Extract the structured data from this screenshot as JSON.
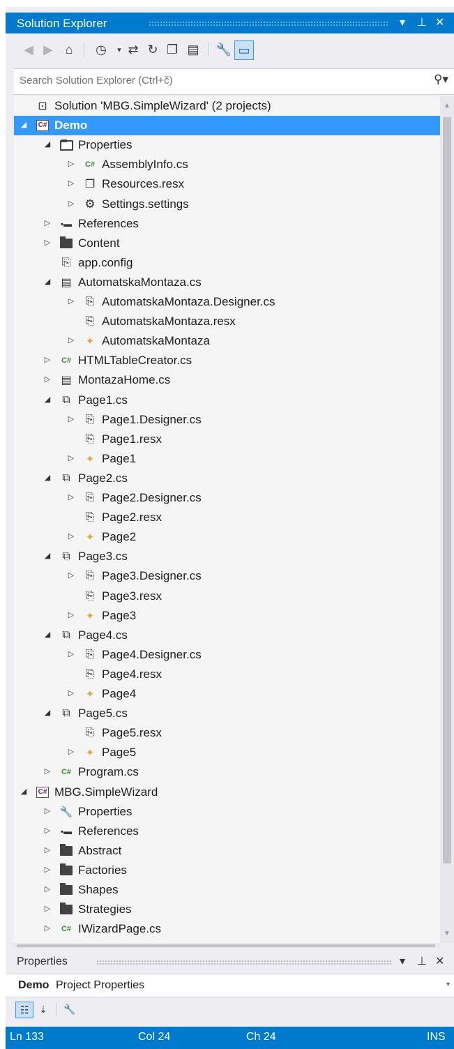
{
  "solution_explorer": {
    "title": "Solution Explorer",
    "controls": {
      "dropdown": "▾",
      "pin": "⊥",
      "close": "✕"
    },
    "search_placeholder": "Search Solution Explorer (Ctrl+č)",
    "toolbar": [
      "back-icon",
      "forward-icon",
      "home-icon",
      "pending-changes-icon",
      "sync-icon",
      "refresh-icon",
      "collapse-all-icon",
      "show-all-files-icon",
      "properties-icon",
      "preview-icon"
    ],
    "tree": [
      {
        "label": "Solution 'MBG.SimpleWizard' (2 projects)",
        "level": 0,
        "icon": "solution-icon",
        "expander": "none"
      },
      {
        "label": "Demo",
        "level": 0,
        "icon": "csproj-icon",
        "expander": "open",
        "selected": true
      },
      {
        "label": "Properties",
        "level": 1,
        "icon": "folder-open-icon",
        "expander": "open"
      },
      {
        "label": "AssemblyInfo.cs",
        "level": 2,
        "icon": "cs-file-icon",
        "expander": "closed"
      },
      {
        "label": "Resources.resx",
        "level": 2,
        "icon": "resx-icon",
        "expander": "closed"
      },
      {
        "label": "Settings.settings",
        "level": 2,
        "icon": "settings-icon",
        "expander": "closed"
      },
      {
        "label": "References",
        "level": 1,
        "icon": "references-icon",
        "expander": "closed"
      },
      {
        "label": "Content",
        "level": 1,
        "icon": "folder-icon",
        "expander": "closed"
      },
      {
        "label": "app.config",
        "level": 1,
        "icon": "config-icon",
        "expander": "none"
      },
      {
        "label": "AutomatskaMontaza.cs",
        "level": 1,
        "icon": "form-icon",
        "expander": "open"
      },
      {
        "label": "AutomatskaMontaza.Designer.cs",
        "level": 2,
        "icon": "designer-icon",
        "expander": "closed"
      },
      {
        "label": "AutomatskaMontaza.resx",
        "level": 2,
        "icon": "designer-icon",
        "expander": "none"
      },
      {
        "label": "AutomatskaMontaza",
        "level": 2,
        "icon": "class-icon",
        "expander": "closed"
      },
      {
        "label": "HTMLTableCreator.cs",
        "level": 1,
        "icon": "cs-file-icon",
        "expander": "closed"
      },
      {
        "label": "MontazaHome.cs",
        "level": 1,
        "icon": "form-icon",
        "expander": "closed"
      },
      {
        "label": "Page1.cs",
        "level": 1,
        "icon": "usercontrol-icon",
        "expander": "open"
      },
      {
        "label": "Page1.Designer.cs",
        "level": 2,
        "icon": "designer-icon",
        "expander": "closed"
      },
      {
        "label": "Page1.resx",
        "level": 2,
        "icon": "designer-icon",
        "expander": "none"
      },
      {
        "label": "Page1",
        "level": 2,
        "icon": "class-icon",
        "expander": "closed"
      },
      {
        "label": "Page2.cs",
        "level": 1,
        "icon": "usercontrol-icon",
        "expander": "open"
      },
      {
        "label": "Page2.Designer.cs",
        "level": 2,
        "icon": "designer-icon",
        "expander": "closed"
      },
      {
        "label": "Page2.resx",
        "level": 2,
        "icon": "designer-icon",
        "expander": "none"
      },
      {
        "label": "Page2",
        "level": 2,
        "icon": "class-icon",
        "expander": "closed"
      },
      {
        "label": "Page3.cs",
        "level": 1,
        "icon": "usercontrol-icon",
        "expander": "open"
      },
      {
        "label": "Page3.Designer.cs",
        "level": 2,
        "icon": "designer-icon",
        "expander": "closed"
      },
      {
        "label": "Page3.resx",
        "level": 2,
        "icon": "designer-icon",
        "expander": "none"
      },
      {
        "label": "Page3",
        "level": 2,
        "icon": "class-icon",
        "expander": "closed"
      },
      {
        "label": "Page4.cs",
        "level": 1,
        "icon": "usercontrol-icon",
        "expander": "open"
      },
      {
        "label": "Page4.Designer.cs",
        "level": 2,
        "icon": "designer-icon",
        "expander": "closed"
      },
      {
        "label": "Page4.resx",
        "level": 2,
        "icon": "designer-icon",
        "expander": "none"
      },
      {
        "label": "Page4",
        "level": 2,
        "icon": "class-icon",
        "expander": "closed"
      },
      {
        "label": "Page5.cs",
        "level": 1,
        "icon": "usercontrol-icon",
        "expander": "open"
      },
      {
        "label": "Page5.resx",
        "level": 2,
        "icon": "designer-icon",
        "expander": "none"
      },
      {
        "label": "Page5",
        "level": 2,
        "icon": "class-icon",
        "expander": "closed"
      },
      {
        "label": "Program.cs",
        "level": 1,
        "icon": "cs-file-icon",
        "expander": "closed"
      },
      {
        "label": "MBG.SimpleWizard",
        "level": 0,
        "icon": "csproj-icon",
        "expander": "open"
      },
      {
        "label": "Properties",
        "level": 1,
        "icon": "wrench-icon",
        "expander": "closed"
      },
      {
        "label": "References",
        "level": 1,
        "icon": "references-icon",
        "expander": "closed"
      },
      {
        "label": "Abstract",
        "level": 1,
        "icon": "folder-icon",
        "expander": "closed"
      },
      {
        "label": "Factories",
        "level": 1,
        "icon": "folder-icon",
        "expander": "closed"
      },
      {
        "label": "Shapes",
        "level": 1,
        "icon": "folder-icon",
        "expander": "closed"
      },
      {
        "label": "Strategies",
        "level": 1,
        "icon": "folder-icon",
        "expander": "closed"
      },
      {
        "label": "IWizardPage.cs",
        "level": 1,
        "icon": "cs-file-icon",
        "expander": "closed"
      }
    ]
  },
  "properties": {
    "title": "Properties",
    "object_name": "Demo",
    "object_type": "Project Properties"
  },
  "status_bar": {
    "line": "Ln 133",
    "col": "Col 24",
    "ch": "Ch 24",
    "mode": "INS"
  },
  "colors": {
    "accent": "#007acc",
    "selection": "#3399ff",
    "panel": "#eeeef2",
    "tree_bg": "#f5f5f5"
  }
}
